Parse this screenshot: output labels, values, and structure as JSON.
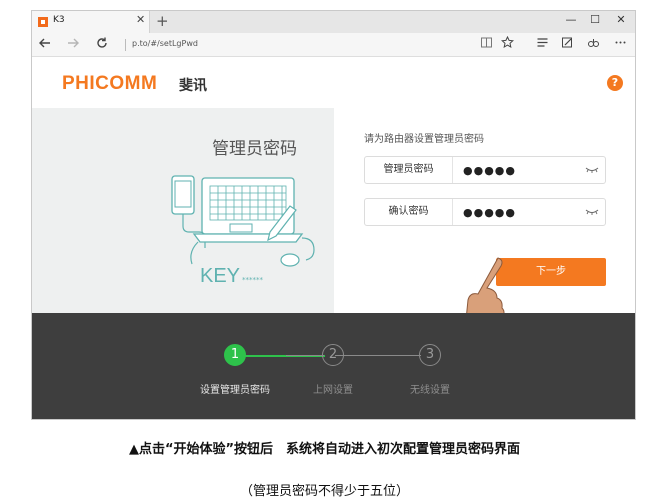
{
  "browser": {
    "tab_title": "K3",
    "tab_close": "✕",
    "new_tab": "+",
    "url": "p.to/#/setLgPwd",
    "window_controls": {
      "minimize": "—",
      "maximize": "☐",
      "close": "✕"
    },
    "icons": [
      "back-icon",
      "forward-icon",
      "refresh-icon",
      "reading-view-icon",
      "favorite-star-icon",
      "hub-icon",
      "web-note-icon",
      "share-icon",
      "more-icon"
    ]
  },
  "header": {
    "logo": "PHICOMM",
    "logo_cn": "斐讯",
    "help": "?"
  },
  "left_panel": {
    "title": "管理员密码",
    "illustration_text": "KEY",
    "illustration_stars": "******"
  },
  "form": {
    "prompt": "请为路由器设置管理员密码",
    "fields": [
      {
        "label": "管理员密码",
        "value": "●●●●●"
      },
      {
        "label": "确认密码",
        "value": "●●●●●"
      }
    ],
    "next_label": "下一步"
  },
  "steps": [
    {
      "number": "1",
      "label": "设置管理员密码",
      "state": "active"
    },
    {
      "number": "2",
      "label": "上网设置",
      "state": "idle"
    },
    {
      "number": "3",
      "label": "无线设置",
      "state": "idle"
    }
  ],
  "captions": {
    "main": "▲点击“开始体验”按钮后　系统将自动进入初次配置管理员密码界面",
    "sub": "（管理员密码不得少于五位）"
  },
  "colors": {
    "brand": "#f47920",
    "step_active": "#2ec24b",
    "steps_bg": "#3e3e3e",
    "panel_bg": "#eef0f0"
  }
}
